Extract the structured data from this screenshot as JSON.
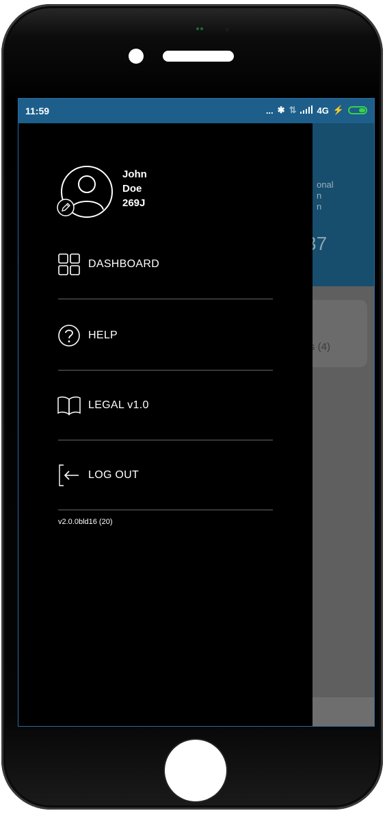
{
  "status_bar": {
    "time": "11:59",
    "indicators": "...",
    "network": "4G",
    "battery_color": "#39d14a",
    "background_color": "#1d5f8a"
  },
  "background_app": {
    "line1": "onal",
    "line2": "n",
    "line3": "n",
    "big_number": "37",
    "card_text": "s (4)"
  },
  "drawer": {
    "profile": {
      "first_name": "John",
      "last_name": "Doe",
      "user_id": "269J",
      "avatar_icon": "user-circle-icon",
      "edit_icon": "pencil-icon"
    },
    "items": [
      {
        "label": "DASHBOARD",
        "icon": "grid-icon"
      },
      {
        "label": "HELP",
        "icon": "question-circle-icon"
      },
      {
        "label": "LEGAL v1.0",
        "icon": "book-icon"
      },
      {
        "label": "LOG OUT",
        "icon": "logout-arrow-icon"
      }
    ],
    "version": "v2.0.0bld16 (20)"
  }
}
